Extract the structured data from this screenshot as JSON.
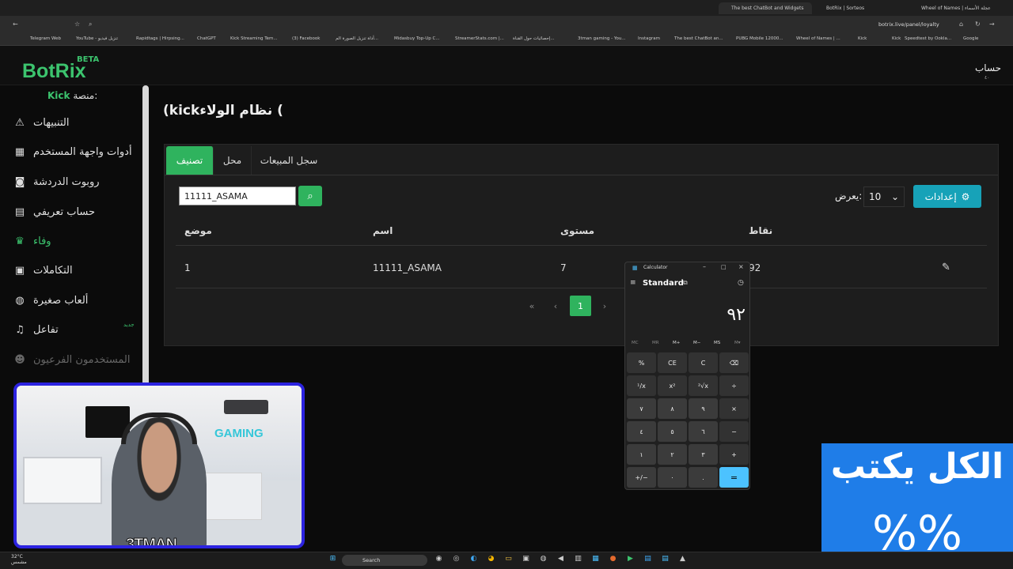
{
  "browser": {
    "tabs": [
      {
        "title": "The best ChatBot and Widgets",
        "active": true
      },
      {
        "title": "BotRix | Sorteos",
        "active": false
      },
      {
        "title": "Wheel of Names | عجلة الأسماء",
        "active": false
      }
    ],
    "url": "botrix.live/panel/loyalty",
    "bookmarks": [
      "Telegram Web",
      "YouTube - تنزيل فيديو",
      "Rapidtags | Hirpsing...",
      "ChatGPT",
      "Kick Streaming Tem...",
      "(3) Facebook",
      "أداة تنزيل الصورة الم...",
      "Midasbuy Top-Up C...",
      "StreamerStats.com |...",
      "إحصائيات حول القناة...",
      "3tman gaming - You...",
      "Instagram",
      "The best ChatBot an...",
      "PUBG Mobile 12000...",
      "Wheel of Names | ...",
      "Kick",
      "Kick",
      "Speedtest by Ookla...",
      "Google"
    ]
  },
  "header": {
    "logo": "BotRix",
    "beta": "BETA",
    "account": "حساب",
    "account_sub": "٤٠"
  },
  "sidebar": {
    "platform_label": "منصة:",
    "platform_value": "Kick",
    "new_badge": "جديد",
    "items": [
      {
        "label": "التنبيهات",
        "icon": "warning-icon"
      },
      {
        "label": "أدوات واجهة المستخدم",
        "icon": "widgets-icon"
      },
      {
        "label": "روبوت الدردشة",
        "icon": "robot-icon"
      },
      {
        "label": "حساب تعريفي",
        "icon": "id-card-icon"
      },
      {
        "label": "وفاء",
        "icon": "trophy-icon"
      },
      {
        "label": "التكاملات",
        "icon": "integrations-icon"
      },
      {
        "label": "ألعاب صغيرة",
        "icon": "gamepad-icon"
      },
      {
        "label": "تفاعل",
        "icon": "music-icon"
      },
      {
        "label": "المستخدمون الفرعيون",
        "icon": "users-icon"
      }
    ]
  },
  "main": {
    "title": "(kickنظام الولاء (",
    "tabs": [
      "تصنيف",
      "محل",
      "سجل المبيعات"
    ],
    "search_value": "11111_ASAMA",
    "settings_label": "إعدادات",
    "show_label": "يعرض:",
    "show_value": "10",
    "table": {
      "headers": [
        "موضع",
        "اسم",
        "مستوى",
        "نقاط"
      ],
      "rows": [
        [
          "1",
          "11111_ASAMA",
          "7",
          "92"
        ]
      ]
    },
    "pagination": {
      "first": "«",
      "prev": "‹",
      "current": "1",
      "next": "›"
    }
  },
  "calculator": {
    "title": "Calculator",
    "mode": "Standard",
    "display": "٩٢",
    "memory": [
      "MC",
      "MR",
      "M+",
      "M−",
      "MS",
      "M▾"
    ],
    "keys": [
      [
        "%",
        "CE",
        "C",
        "⌫"
      ],
      [
        "¹/x",
        "x²",
        "²√x",
        "÷"
      ],
      [
        "٧",
        "٨",
        "٩",
        "×"
      ],
      [
        "٤",
        "٥",
        "٦",
        "−"
      ],
      [
        "١",
        "٢",
        "٣",
        "+"
      ],
      [
        "+/−",
        "٠",
        ".",
        "="
      ]
    ]
  },
  "webcam": {
    "wall_text": "GAMING",
    "streamer": "3TMAN"
  },
  "overlay": {
    "line1": "الكل يكتب",
    "line2": "%%"
  },
  "taskbar": {
    "temp": "32°C",
    "weather": "مشمس",
    "search": "Search"
  }
}
